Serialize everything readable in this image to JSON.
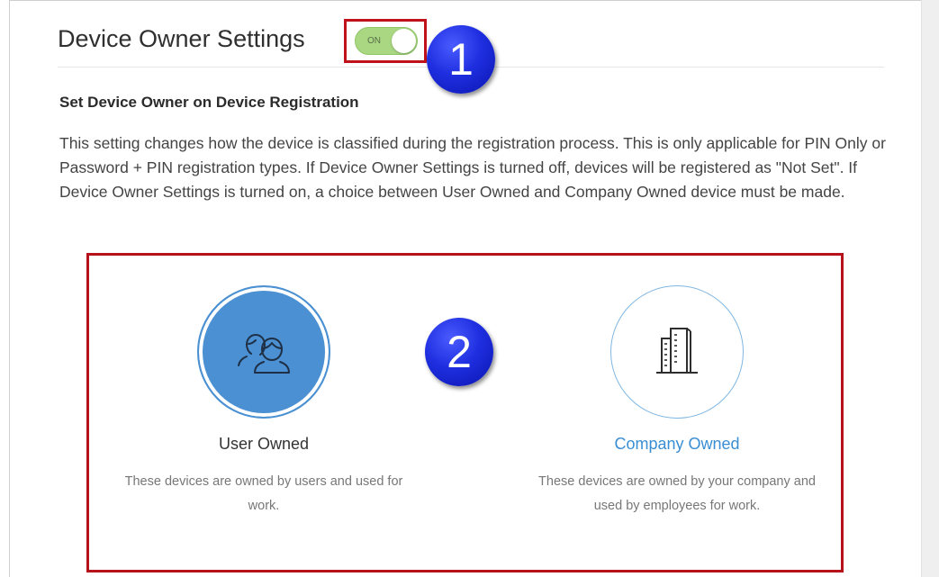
{
  "header": {
    "title": "Device Owner Settings",
    "toggle_label": "ON"
  },
  "badges": {
    "first": "1",
    "second": "2"
  },
  "section": {
    "heading": "Set Device Owner on Device Registration",
    "description": "This setting changes how the device is classified during the registration process. This is only applicable for PIN Only or Password + PIN registration types. If Device Owner Settings is turned off, devices will be registered as \"Not Set\". If Device Owner Settings is turned on, a choice between User Owned and Company Owned device must be made."
  },
  "options": [
    {
      "icon": "users-icon",
      "title": "User Owned",
      "description": "These devices are owned by users and used for work.",
      "selected": true
    },
    {
      "icon": "building-icon",
      "title": "Company Owned",
      "description": "These devices are owned by your company and used by employees for work.",
      "selected": false
    }
  ],
  "colors": {
    "toggle_on": "#a9d782",
    "highlight_border": "#b5121b",
    "badge_blue": "#1f2fe0",
    "selected_circle": "#4a90d2",
    "link_blue": "#3a8ed3"
  }
}
